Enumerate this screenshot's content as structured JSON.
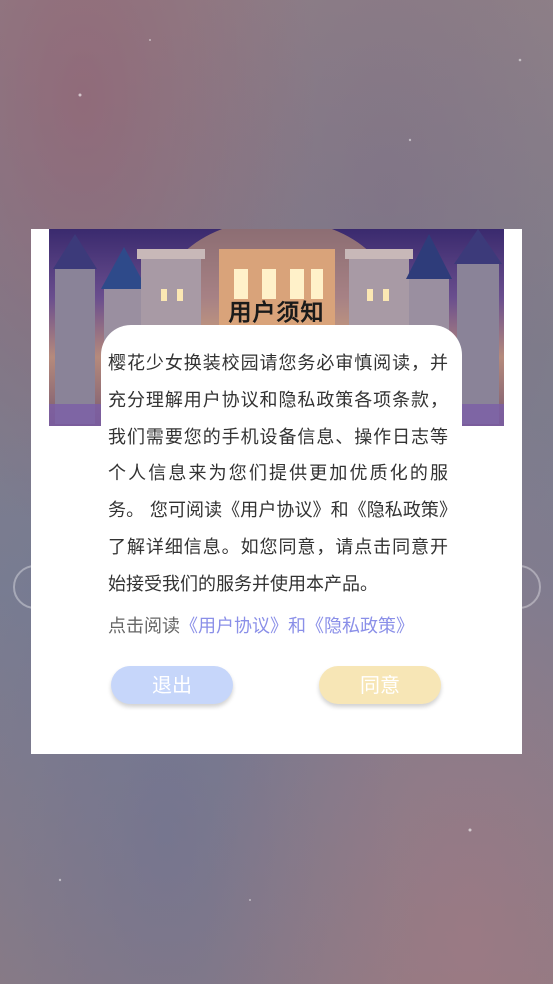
{
  "dialog": {
    "title": "用户须知",
    "body": "樱花少女换装校园请您务必审慎阅读，并充分理解用户协议和隐私政策各项条款，我们需要您的手机设备信息、操作日志等个人信息来为您们提供更加优质化的服务。 您可阅读《用户协议》和《隐私政策》了解详细信息。如您同意，请点击同意开始接受我们的服务并使用本产品。",
    "read_prefix": "点击阅读",
    "read_link": "《用户协议》和《隐私政策》",
    "exit_label": "退出",
    "agree_label": "同意"
  },
  "colors": {
    "exit_button": "#c6d6fa",
    "agree_button": "#f7e6b6",
    "link": "#8a8fe8"
  }
}
